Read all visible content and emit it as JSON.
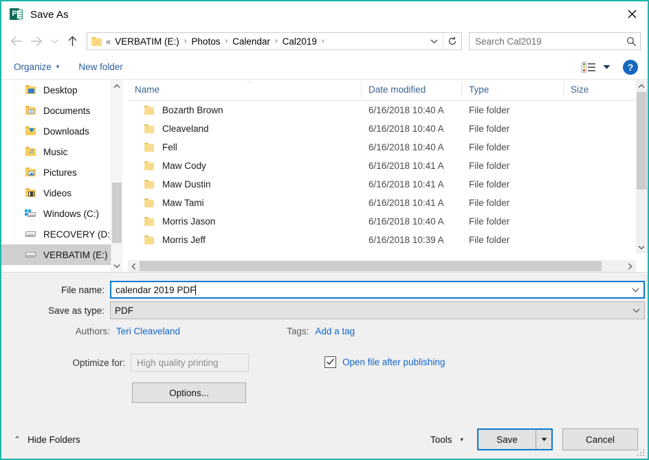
{
  "window": {
    "title": "Save As",
    "app_icon": "powerpoint-icon",
    "close_label": "✕",
    "border_color": "#1cb5ac"
  },
  "nav": {
    "back_icon": "arrow-left-icon",
    "forward_icon": "arrow-right-icon",
    "recent_icon": "chevron-down-icon",
    "up_icon": "arrow-up-icon",
    "breadcrumb_lead": "«",
    "breadcrumbs": [
      "VERBATIM (E:)",
      "Photos",
      "Calendar",
      "Cal2019"
    ],
    "separator": "›",
    "dropdown_icon": "chevron-down-icon",
    "refresh_icon": "refresh-icon"
  },
  "search": {
    "placeholder": "Search Cal2019",
    "icon": "search-icon"
  },
  "toolbar": {
    "organize_label": "Organize",
    "organize_caret": "▾",
    "new_folder_label": "New folder",
    "view_icon": "view-list-icon",
    "view_caret": "▾",
    "help_label": "?"
  },
  "sidebar": {
    "items": [
      {
        "label": "Desktop",
        "icon": "desktop-folder-icon",
        "selected": false
      },
      {
        "label": "Documents",
        "icon": "documents-folder-icon",
        "selected": false
      },
      {
        "label": "Downloads",
        "icon": "downloads-folder-icon",
        "selected": false
      },
      {
        "label": "Music",
        "icon": "music-folder-icon",
        "selected": false
      },
      {
        "label": "Pictures",
        "icon": "pictures-folder-icon",
        "selected": false
      },
      {
        "label": "Videos",
        "icon": "videos-folder-icon",
        "selected": false
      },
      {
        "label": "Windows (C:)",
        "icon": "windows-drive-icon",
        "selected": false
      },
      {
        "label": "RECOVERY (D:)",
        "icon": "drive-icon",
        "selected": false
      },
      {
        "label": "VERBATIM (E:)",
        "icon": "drive-icon",
        "selected": true
      }
    ],
    "scroll_up_icon": "chevron-up-icon",
    "scroll_down_icon": "chevron-down-icon"
  },
  "filelist": {
    "columns": [
      "Name",
      "Date modified",
      "Type",
      "Size"
    ],
    "sort_indicator": "⌃",
    "rows": [
      {
        "name": "Bozarth Brown",
        "date": "6/16/2018 10:40 A",
        "type": "File folder",
        "size": ""
      },
      {
        "name": "Cleaveland",
        "date": "6/16/2018 10:40 A",
        "type": "File folder",
        "size": ""
      },
      {
        "name": "Fell",
        "date": "6/16/2018 10:40 A",
        "type": "File folder",
        "size": ""
      },
      {
        "name": "Maw Cody",
        "date": "6/16/2018 10:41 A",
        "type": "File folder",
        "size": ""
      },
      {
        "name": "Maw Dustin",
        "date": "6/16/2018 10:41 A",
        "type": "File folder",
        "size": ""
      },
      {
        "name": "Maw Tami",
        "date": "6/16/2018 10:41 A",
        "type": "File folder",
        "size": ""
      },
      {
        "name": "Morris Jason",
        "date": "6/16/2018 10:40 A",
        "type": "File folder",
        "size": ""
      },
      {
        "name": "Morris Jeff",
        "date": "6/16/2018 10:39 A",
        "type": "File folder",
        "size": ""
      }
    ],
    "hscroll_left_icon": "chevron-left-icon",
    "hscroll_right_icon": "chevron-right-icon",
    "vscroll_up_icon": "chevron-up-icon",
    "vscroll_down_icon": "chevron-down-icon"
  },
  "form": {
    "filename_label": "File name:",
    "filename_value": "calendar 2019 PDF",
    "savetype_label": "Save as type:",
    "savetype_value": "PDF",
    "authors_label": "Authors:",
    "authors_value": "Teri Cleaveland",
    "tags_label": "Tags:",
    "tags_value": "Add a tag",
    "optimize_label": "Optimize for:",
    "optimize_value": "High quality printing",
    "open_after_label": "Open file after publishing",
    "open_after_checked": true,
    "options_label": "Options...",
    "combo_arrow": "∨"
  },
  "footer": {
    "hide_folders_label": "Hide Folders",
    "hide_folders_caret": "⌃",
    "tools_label": "Tools",
    "tools_caret": "▾",
    "save_label": "Save",
    "save_split_caret": "▾",
    "cancel_label": "Cancel"
  }
}
